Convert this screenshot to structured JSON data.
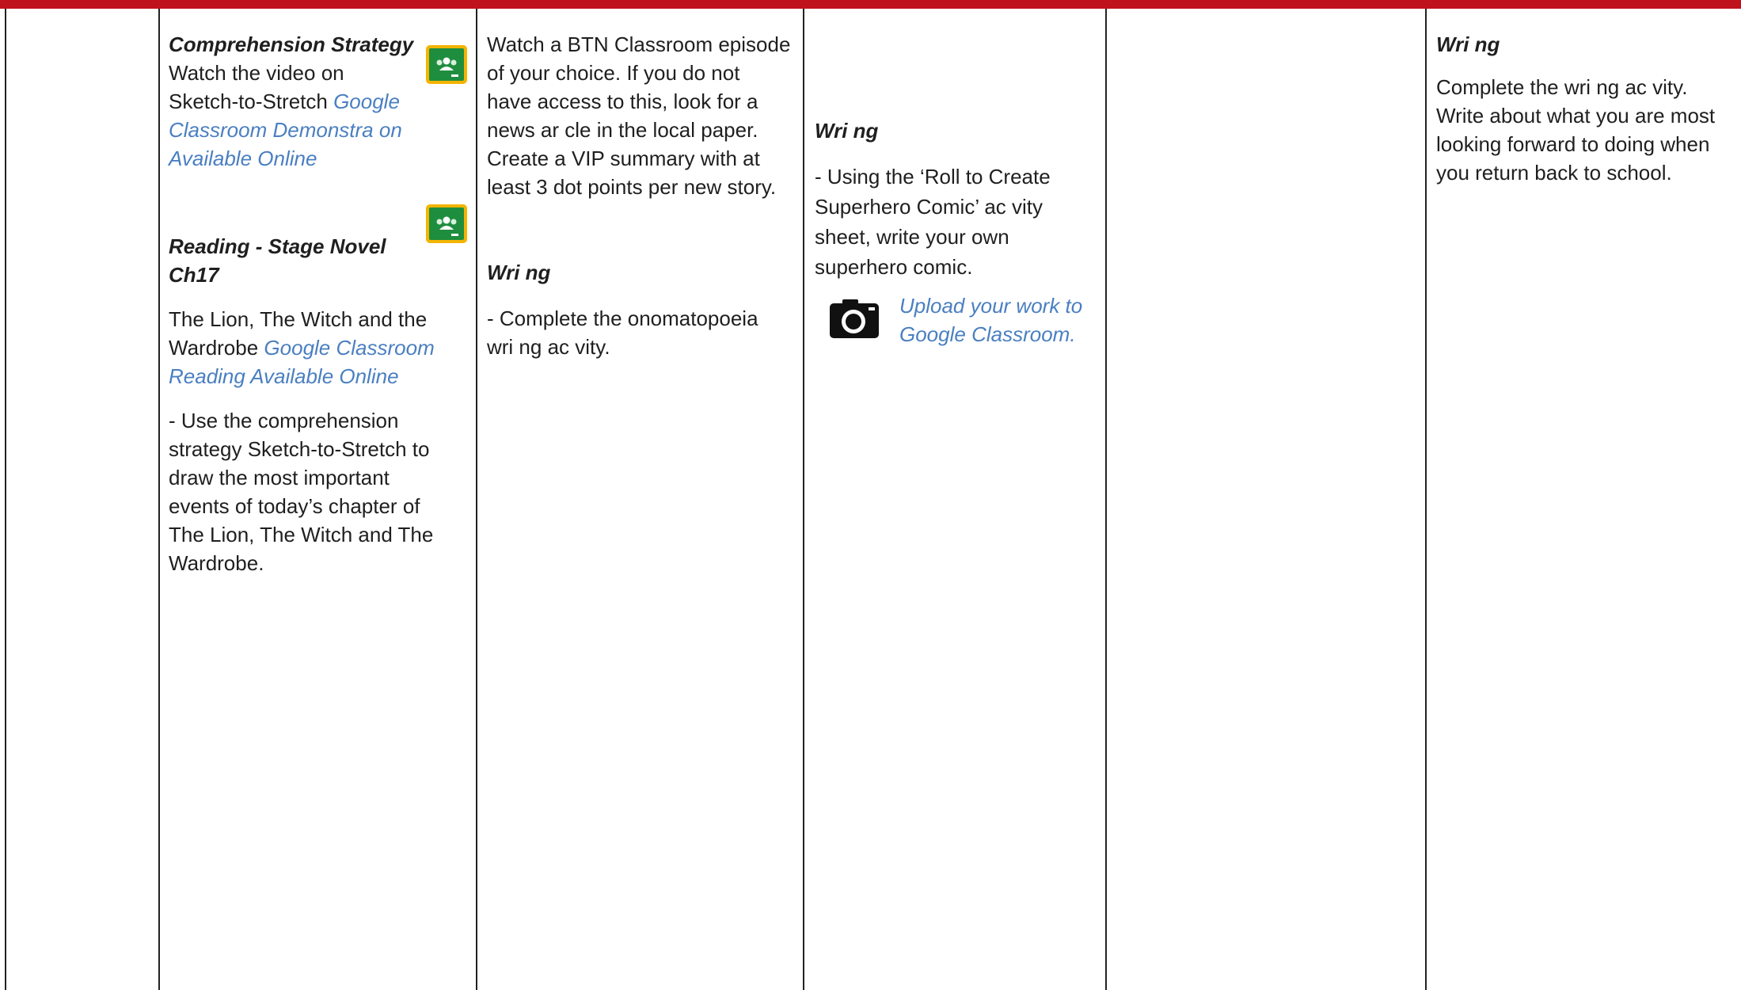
{
  "col2": {
    "heading1": "Comprehension Strategy",
    "line1": "Watch the video on",
    "line2_text": "Sketch-to-Stretch ",
    "line2_link": "Google",
    "link_line3": "Classroom Demonstra  on",
    "link_line4": "Available Online",
    "heading2_line1": "Reading - Stage Novel",
    "heading2_line2": "Ch17",
    "p1_line1": "The Lion, The Witch and the",
    "p1_line2_text": "Wardrobe ",
    "p1_line2_link": "Google Classroom",
    "p1_line3_link": "Reading Available Online",
    "p2_lines": [
      "- Use the comprehension",
      "strategy Sketch-to-Stretch to",
      "draw the most important",
      "events of today’s chapter of",
      "The Lion, The Witch and The",
      "Wardrobe."
    ]
  },
  "col3": {
    "p1_lines": [
      "Watch a BTN Classroom episode",
      "of your choice. If you do not",
      "have access to this, look for a",
      "news ar  cle in the local paper.",
      "Create a VIP summary with at",
      "least 3 dot points per new story."
    ],
    "heading": "Wri  ng",
    "p2_lines": [
      "- Complete the onomatopoeia",
      "wri  ng ac  vity."
    ]
  },
  "col4": {
    "heading": "Wri  ng",
    "p_lines": [
      "- Using the ‘Roll to Create",
      "Superhero Comic’ ac  vity",
      "sheet, write your own",
      "superhero comic."
    ],
    "upload_line1": "Upload your work to",
    "upload_line2": "Google Classroom."
  },
  "col6": {
    "heading": "Wri  ng",
    "p_lines": [
      "Complete the wri  ng ac  vity.",
      "Write about what you are most",
      "looking forward to doing when",
      "you return back to school."
    ]
  },
  "icons": {
    "classroom": "google-classroom-icon",
    "camera": "camera-icon"
  },
  "colors": {
    "header_bar": "#c0121c",
    "link": "#4a7fc1"
  }
}
